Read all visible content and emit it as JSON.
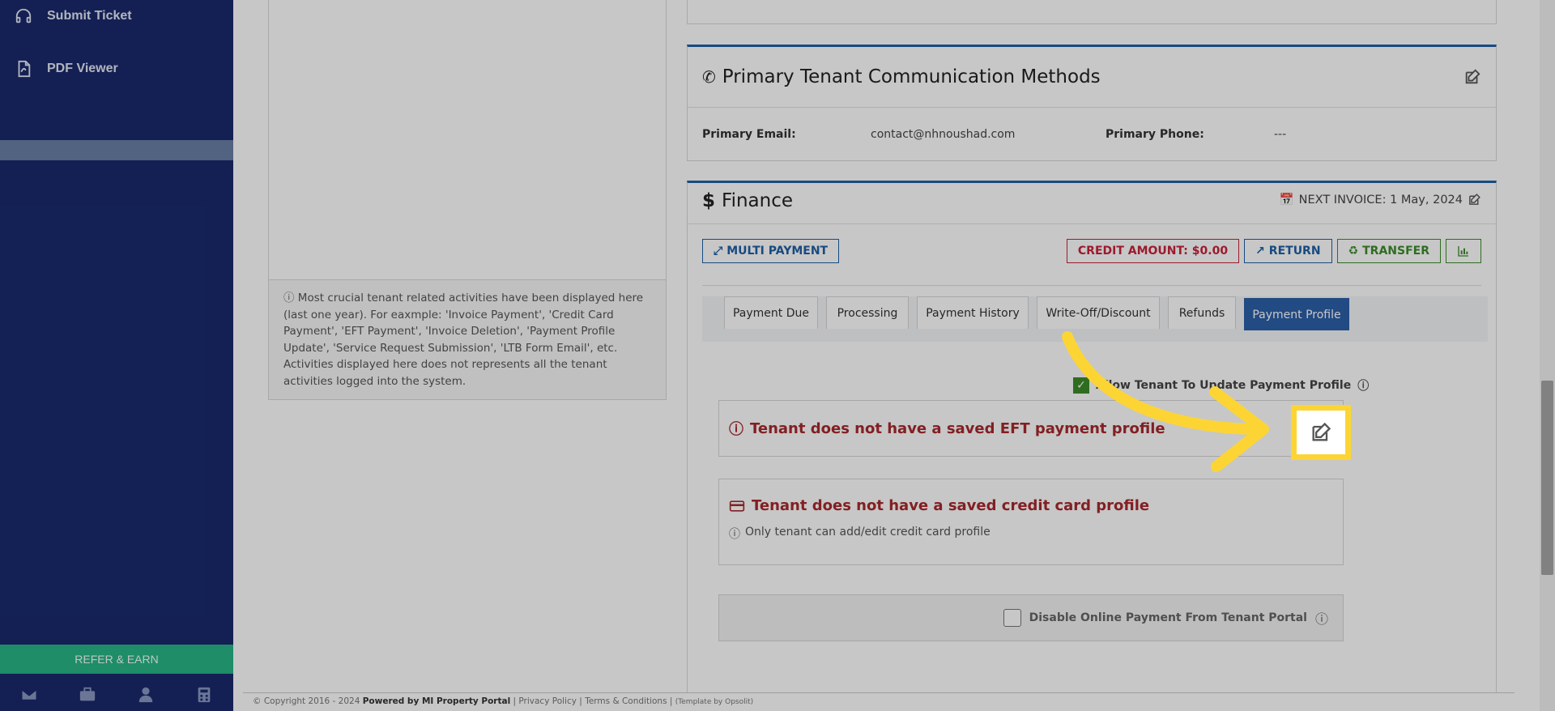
{
  "sidebar": {
    "items": [
      {
        "label": "Submit Ticket",
        "icon": "headset-icon"
      },
      {
        "label": "PDF Viewer",
        "icon": "pdf-icon"
      }
    ],
    "refer_label": "REFER & EARN",
    "bottom_icons": [
      "mail-icon",
      "briefcase-icon",
      "user-icon",
      "calculator-icon"
    ]
  },
  "activity_note": "Most crucial tenant related activities have been displayed here (last one year). For eaxmple: 'Invoice Payment', 'Credit Card Payment', 'EFT Payment', 'Invoice Deletion', 'Payment Profile Update', 'Service Request Submission', 'LTB Form Email', etc. Activities displayed here does not represents all the tenant activities logged into the system.",
  "communication": {
    "title": "Primary Tenant Communication Methods",
    "email_label": "Primary Email:",
    "email_value": "contact@nhnoushad.com",
    "phone_label": "Primary Phone:",
    "phone_value": "---"
  },
  "finance": {
    "title": "Finance",
    "next_invoice": "NEXT INVOICE: 1 May, 2024",
    "buttons": {
      "multi_payment": "MULTI PAYMENT",
      "credit_amount": "CREDIT AMOUNT: $0.00",
      "return": "RETURN",
      "transfer": "TRANSFER"
    },
    "tabs": [
      "Payment Due",
      "Processing",
      "Payment History",
      "Write-Off/Discount",
      "Refunds",
      "Payment Profile"
    ],
    "active_tab": "Payment Profile",
    "allow_update_label": "Allow Tenant To Update Payment Profile",
    "eft_message": "Tenant does not have a saved EFT payment profile",
    "cc_message": "Tenant does not have a saved credit card profile",
    "cc_note": "Only tenant can add/edit credit card profile",
    "disable_online_label": "Disable Online Payment From Tenant Portal"
  },
  "footer": {
    "copyright": "© Copyright 2016 - 2024",
    "powered": "Powered by MI Property Portal",
    "privacy": "Privacy Policy",
    "terms": "Terms & Conditions",
    "template": "(Template by Opsolit)"
  },
  "colors": {
    "sidebar": "#1a2a6c",
    "accent": "#1f5fa6",
    "danger": "#c8223a",
    "success": "#3c8c2a",
    "highlight": "#fcd535",
    "refer": "#27b586"
  }
}
